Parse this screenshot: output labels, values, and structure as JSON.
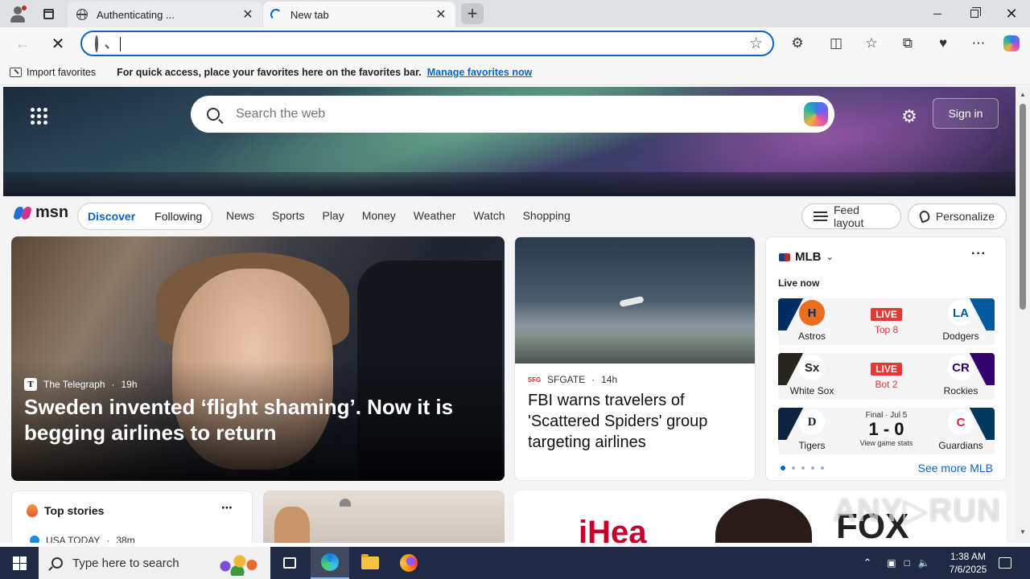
{
  "browser": {
    "tabs": [
      {
        "title": "Authenticating ...",
        "favicon": "globe-icon",
        "close": "✕"
      },
      {
        "title": "New tab",
        "favicon": "loading-spinner",
        "close": "✕"
      }
    ],
    "new_tab_label": "+",
    "window_controls": {
      "minimize": "",
      "restore": "",
      "close": "✕"
    },
    "address_bar": {
      "value": "",
      "placeholder": ""
    },
    "icons": [
      "back-icon",
      "stop-icon",
      "search-icon",
      "favorite-star-icon",
      "extensions-icon",
      "split-screen-icon",
      "favorites-icon",
      "collections-icon",
      "browser-essentials-icon",
      "more-icon",
      "copilot-icon"
    ]
  },
  "favorites_bar": {
    "import_label": "Import favorites",
    "message": "For quick access, place your favorites here on the favorites bar.",
    "manage_link": "Manage favorites now"
  },
  "msn": {
    "search_placeholder": "Search the web",
    "sign_in": "Sign in",
    "logo_text": "msn",
    "pill_tabs": [
      "Discover",
      "Following"
    ],
    "nav_links": [
      "News",
      "Sports",
      "Play",
      "Money",
      "Weather",
      "Watch",
      "Shopping"
    ],
    "feed_layout": "Feed layout",
    "personalize": "Personalize",
    "lead_story": {
      "source": "The Telegraph",
      "age": "19h",
      "headline": "Sweden invented ‘flight shaming’. Now it is begging airlines to return"
    },
    "second_story": {
      "source": "SFGATE",
      "age": "14h",
      "headline": "FBI warns travelers of 'Scattered Spiders' group targeting airlines"
    },
    "mlb": {
      "title": "MLB",
      "more": "···",
      "live_now": "Live now",
      "games": [
        {
          "home": "Astros",
          "away": "Dodgers",
          "status": "LIVE",
          "detail": "Top 8",
          "home_color": "#002d62",
          "away_color": "#005a9c"
        },
        {
          "home": "White Sox",
          "away": "Rockies",
          "status": "LIVE",
          "detail": "Bot 2",
          "home_color": "#27251f",
          "away_color": "#33006f"
        },
        {
          "home": "Tigers",
          "away": "Guardians",
          "final": "Final · Jul 5",
          "score": "1 - 0",
          "link": "View game stats",
          "home_color": "#0c2340",
          "away_color": "#00385d"
        }
      ],
      "see_more": "See more MLB"
    },
    "top_stories": {
      "title": "Top stories",
      "source": "USA TODAY",
      "age": "38m"
    },
    "iheart_logo": "iHea",
    "fox_logo": "FOX"
  },
  "watermark": "ANY▷RUN",
  "taskbar": {
    "search_placeholder": "Type here to search",
    "time": "1:38 AM",
    "date": "7/6/2025"
  }
}
